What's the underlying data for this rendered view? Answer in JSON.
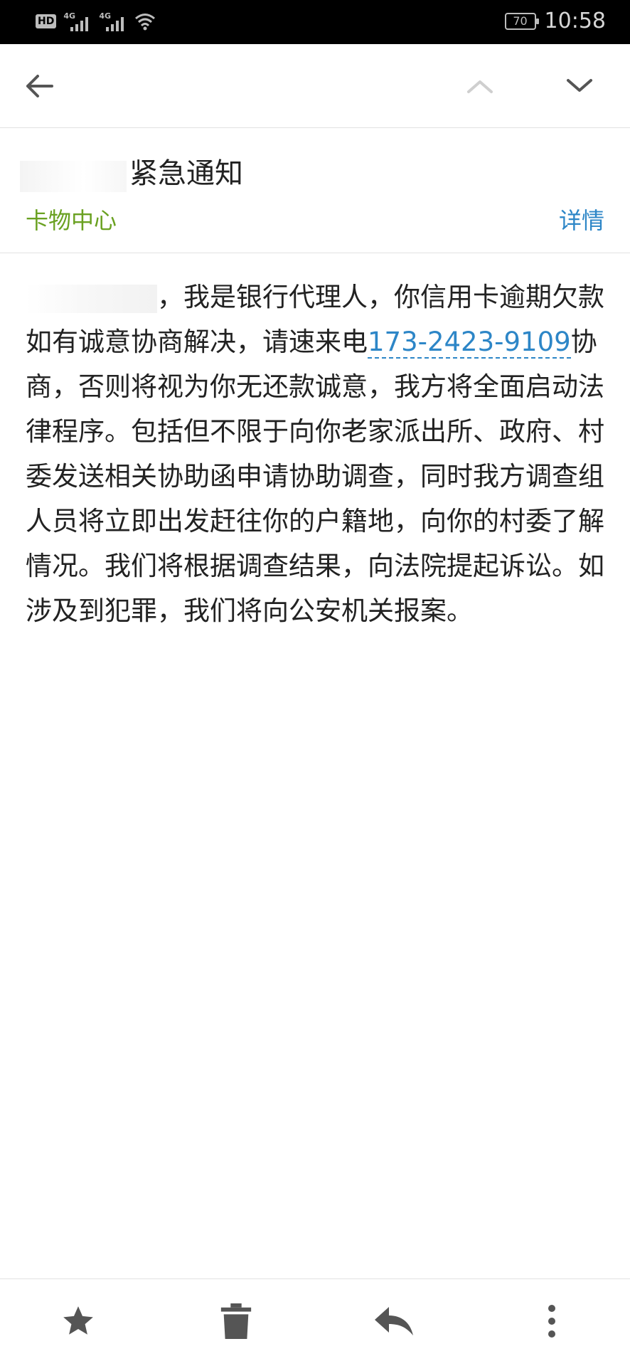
{
  "status_bar": {
    "hd_label": "HD",
    "network1_label": "4G",
    "network2_label": "4G",
    "battery_level": "70",
    "time": "10:58",
    "icon_color": "#bdbdbd"
  },
  "toolbar": {
    "back_icon": "arrow-left-icon",
    "prev_icon": "chevron-up-icon",
    "next_icon": "chevron-down-icon"
  },
  "message": {
    "subject": "紧急通知",
    "sender": "卡物中心",
    "details_label": "详情",
    "body_part1": "，我是银行代理人，你信用卡逾期欠款如有诚意协商解决，请速来电",
    "phone": "173-2423-9109",
    "body_part2": "协商，否则将视为你无还款诚意，我方将全面启动法律程序。包括但不限于向你老家派出所、政府、村委发送相关协助函申请协助调查，同时我方调查组人员将立即出发赶往你的户籍地，向你的村委了解情况。我们将根据调查结果，向法院提起诉讼。如涉及到犯罪，我们将向公安机关报案。"
  },
  "colors": {
    "sender": "#6aa121",
    "link": "#2d86c7",
    "icon": "#555555"
  },
  "bottom_bar": {
    "star_icon": "star-icon",
    "delete_icon": "trash-icon",
    "reply_icon": "reply-icon",
    "more_icon": "more-vertical-icon"
  }
}
